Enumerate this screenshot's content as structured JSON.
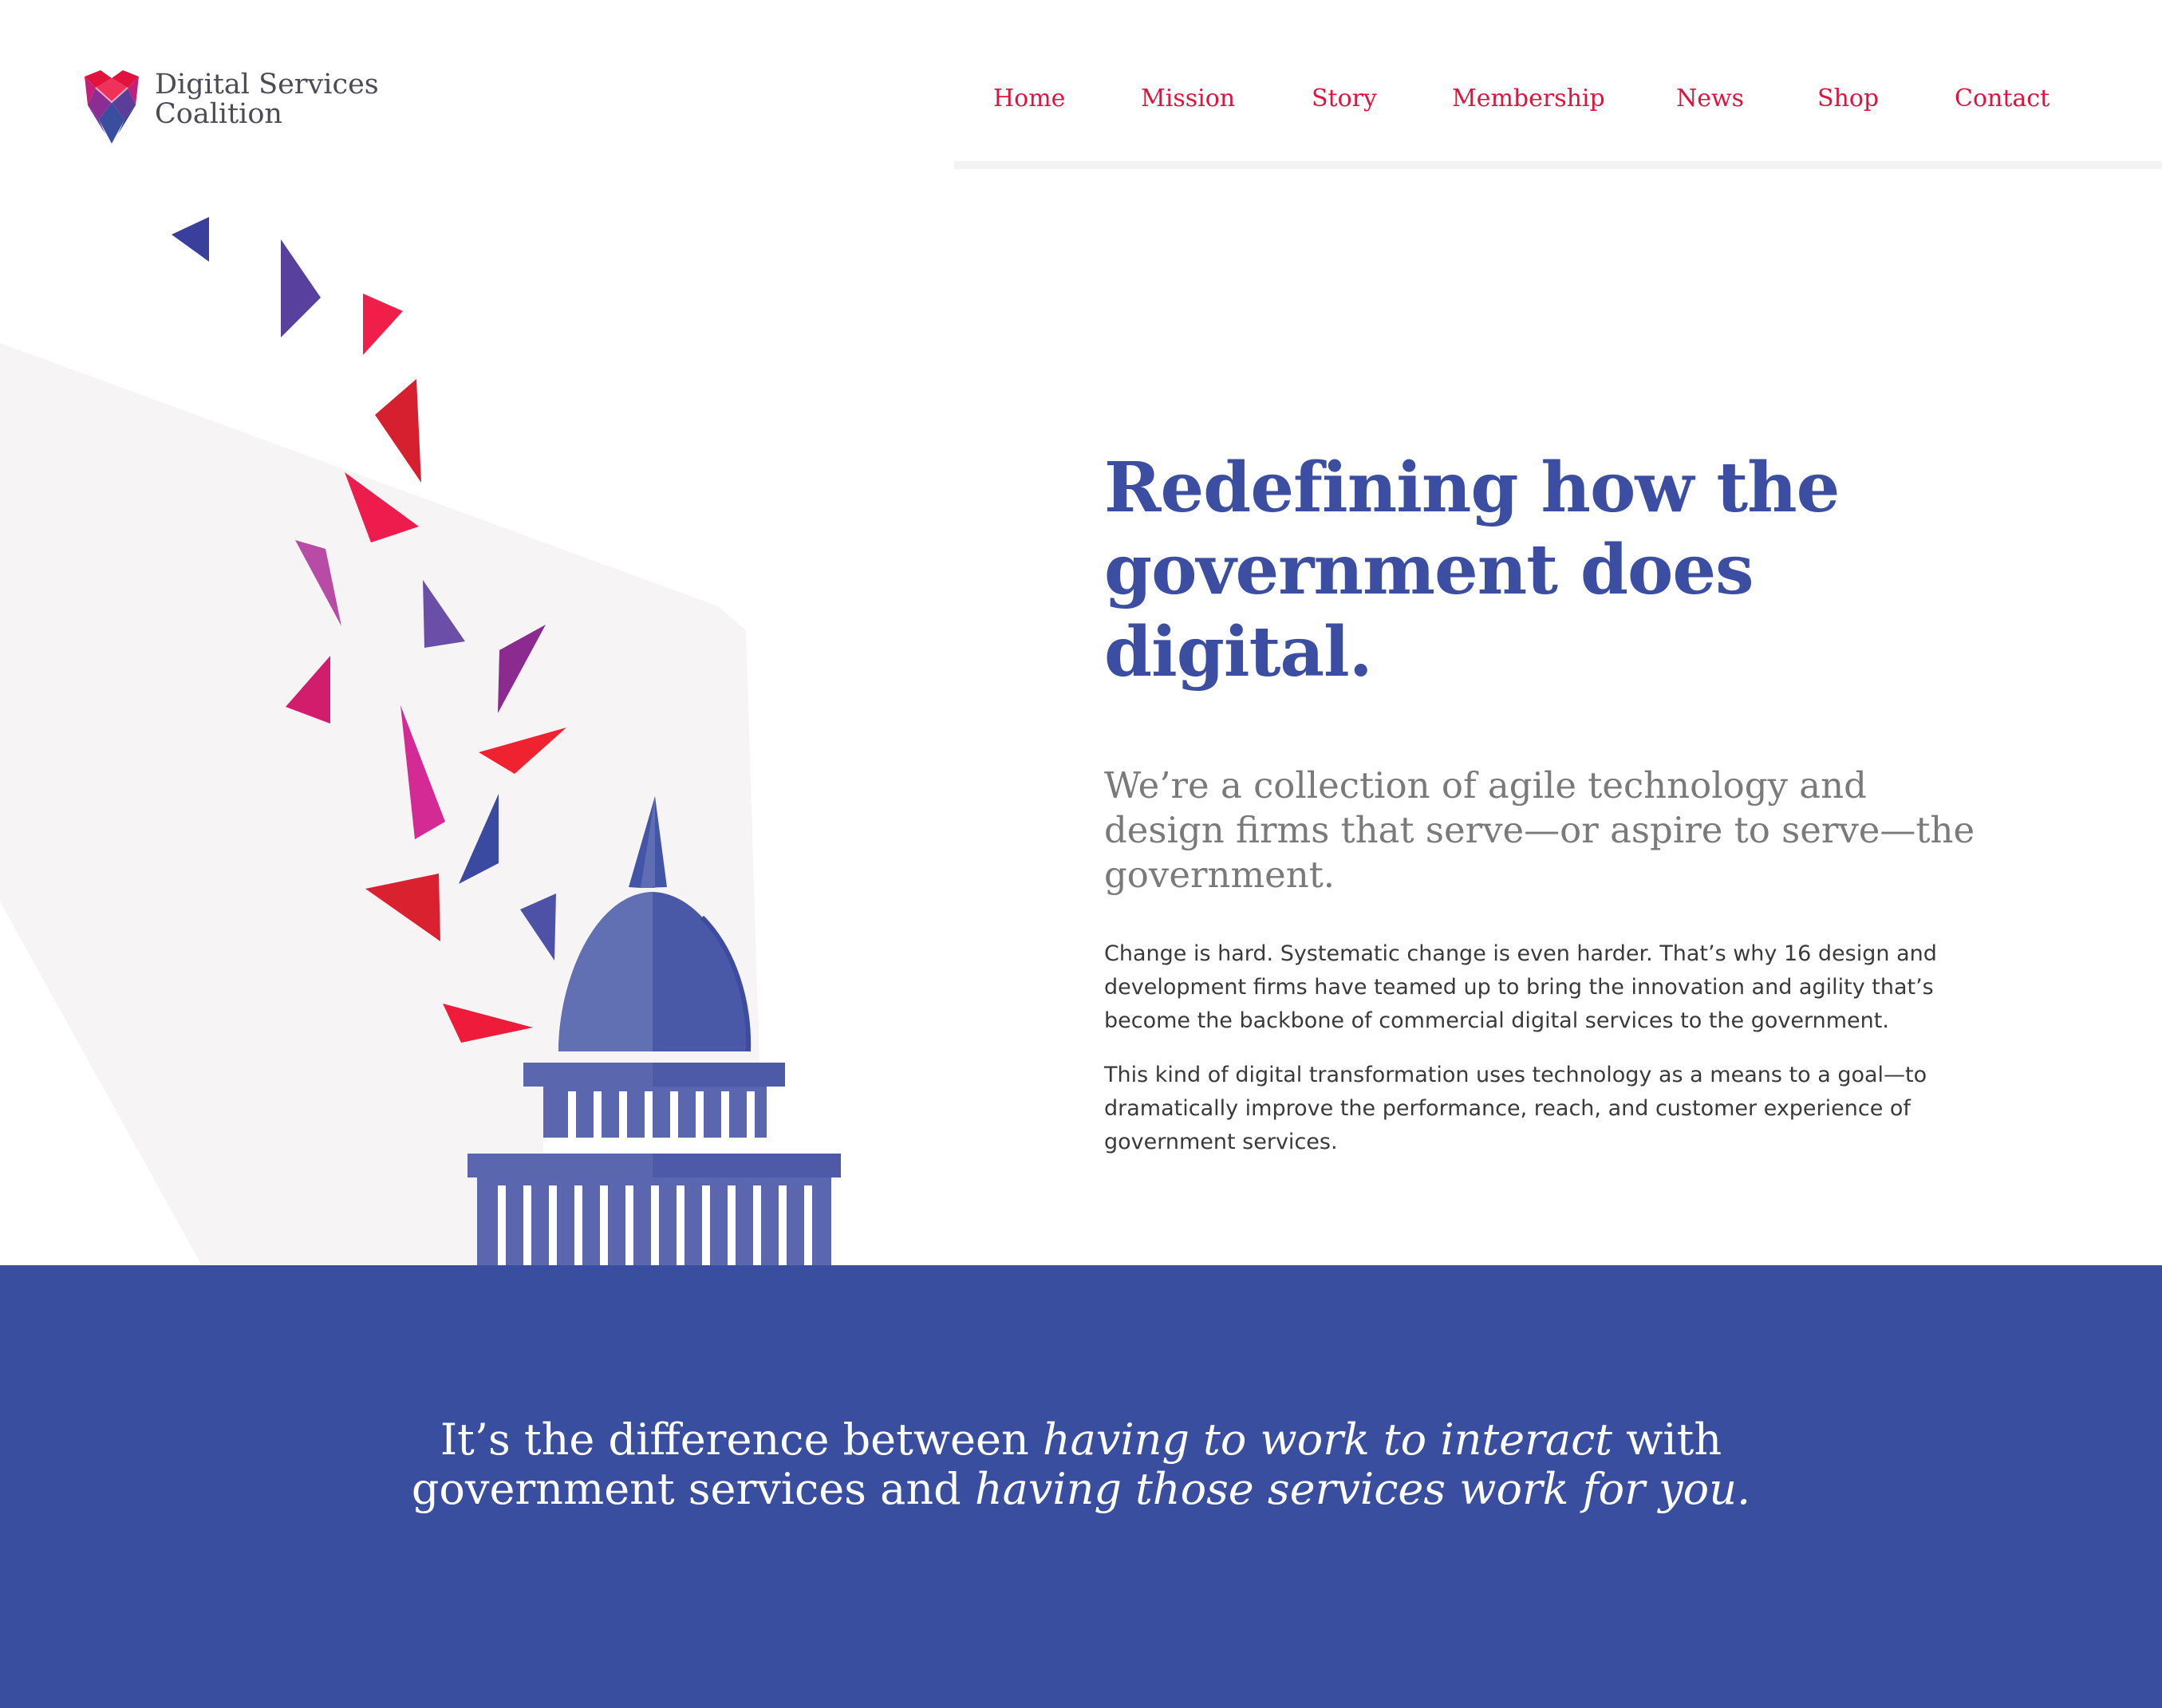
{
  "brand": {
    "line1": "Digital Services",
    "line2": "Coalition",
    "logo_icon": "faceted-shield-logo",
    "colors": {
      "red": "#e1133c",
      "blue": "#3a4ea0",
      "purple": "#5a3e9a",
      "magenta": "#c2207a"
    }
  },
  "nav": {
    "items": [
      {
        "label": "Home"
      },
      {
        "label": "Mission"
      },
      {
        "label": "Story"
      },
      {
        "label": "Membership"
      },
      {
        "label": "News"
      },
      {
        "label": "Shop"
      },
      {
        "label": "Contact"
      }
    ]
  },
  "hero": {
    "headline_line1": "Redefining how the",
    "headline_line2": "government does digital.",
    "subhead": "We’re a collection of agile technology and design firms that serve—or aspire to serve—the government.",
    "paragraph1": "Change is hard. Systematic change is even harder. That’s why 16 design and development firms have teamed up to bring the innovation and agility that’s become the backbone of commercial digital services to the government.",
    "paragraph2": "This kind of digital transformation uses technology as a means to a goal—to dramatically improve the performance, reach, and customer experience of government services.",
    "illustration": "capitol-dome-with-confetti"
  },
  "banner": {
    "seg1": "It’s the difference between ",
    "seg2": "having to work to interact",
    "seg3": " with",
    "seg4": "government services and ",
    "seg5": "having those services work for you."
  }
}
